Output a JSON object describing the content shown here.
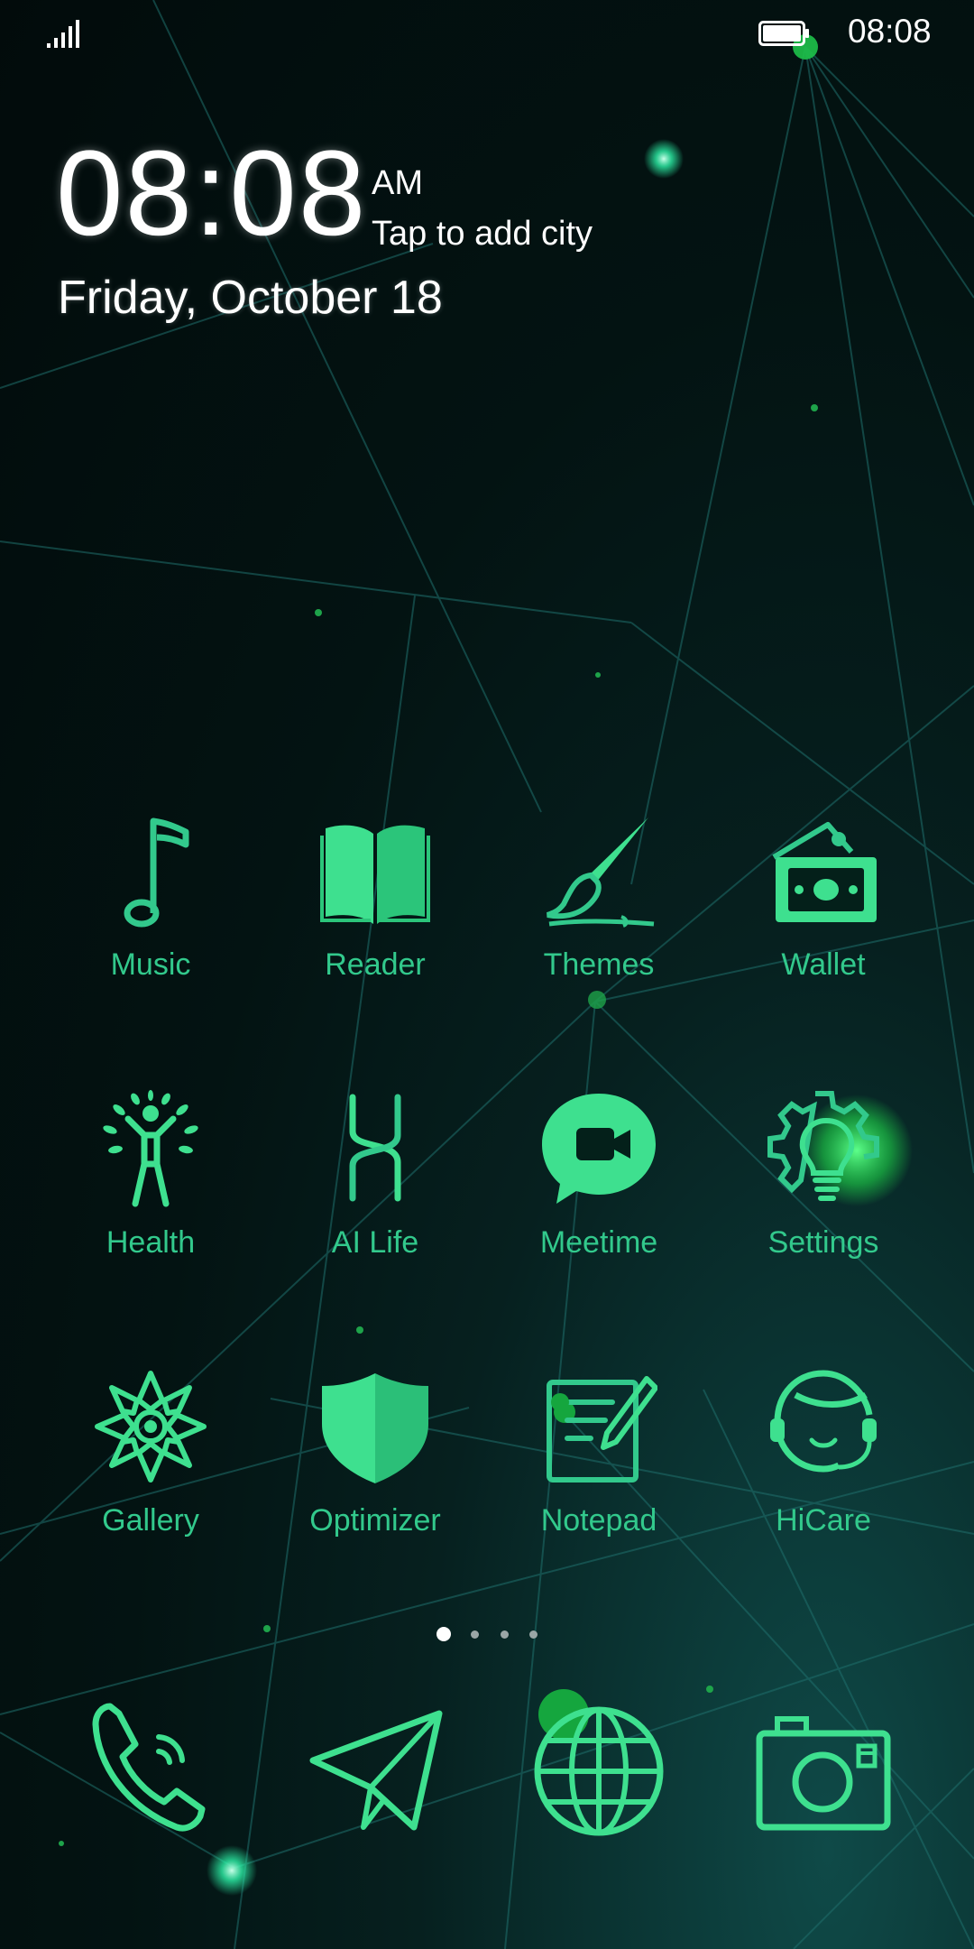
{
  "status_bar": {
    "time": "08:08",
    "icons": [
      "signal-icon",
      "battery-icon"
    ]
  },
  "clock_widget": {
    "time": "08:08",
    "ampm": "AM",
    "city_prompt": "Tap to add city",
    "date": "Friday, October 18"
  },
  "apps": [
    {
      "label": "Music",
      "icon": "music-note-icon"
    },
    {
      "label": "Reader",
      "icon": "book-icon"
    },
    {
      "label": "Themes",
      "icon": "paintbrush-icon"
    },
    {
      "label": "Wallet",
      "icon": "wallet-icon"
    },
    {
      "label": "Health",
      "icon": "health-person-icon"
    },
    {
      "label": "AI Life",
      "icon": "ai-life-icon"
    },
    {
      "label": "Meetime",
      "icon": "video-call-icon"
    },
    {
      "label": "Settings",
      "icon": "gear-bulb-icon"
    },
    {
      "label": "Gallery",
      "icon": "flower-icon"
    },
    {
      "label": "Optimizer",
      "icon": "shield-icon"
    },
    {
      "label": "Notepad",
      "icon": "notepad-icon"
    },
    {
      "label": "HiCare",
      "icon": "headset-icon"
    }
  ],
  "page_indicator": {
    "pages": 4,
    "current": 1
  },
  "dock": [
    {
      "icon": "phone-icon"
    },
    {
      "icon": "paper-plane-icon"
    },
    {
      "icon": "globe-icon"
    },
    {
      "icon": "camera-icon"
    }
  ],
  "colors": {
    "icon_green": "#32c98c",
    "icon_fill": "#3ee08f",
    "background": "#03100f"
  }
}
